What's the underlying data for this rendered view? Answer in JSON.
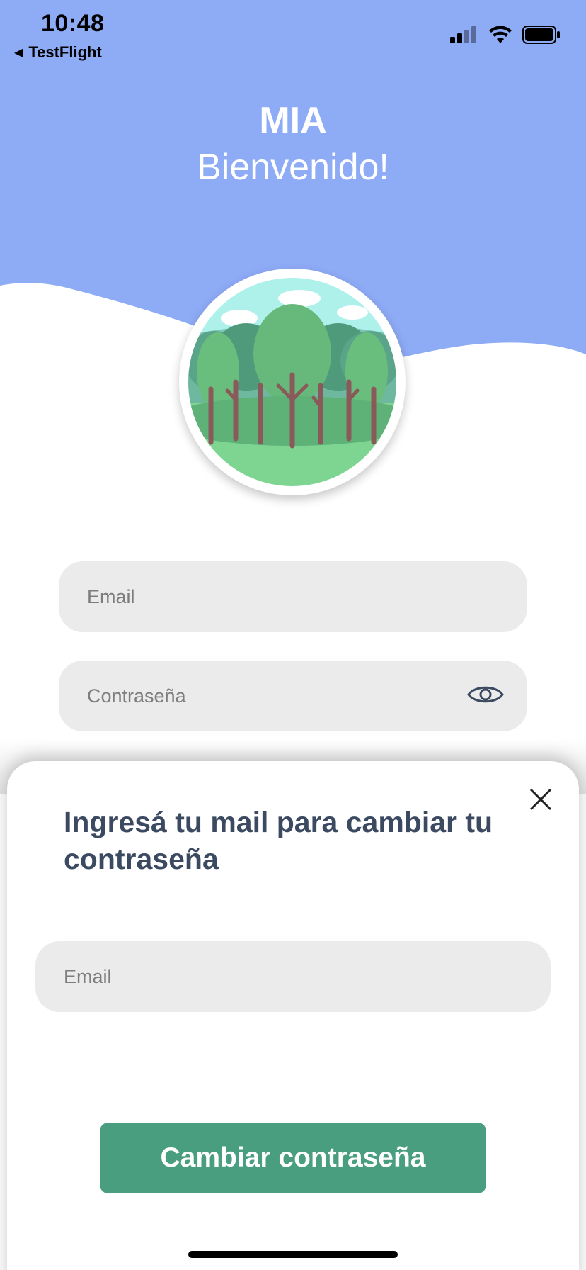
{
  "status_bar": {
    "time": "10:48",
    "back_app": "TestFlight",
    "icons": [
      "cellular-signal-icon",
      "wifi-icon",
      "battery-icon"
    ]
  },
  "header": {
    "app_title": "MIA",
    "welcome": "Bienvenido!",
    "background_color": "#8eabf6"
  },
  "login_form": {
    "email_placeholder": "Email",
    "password_placeholder": "Contraseña",
    "password_toggle_icon": "eye-icon"
  },
  "reset_sheet": {
    "title": "Ingresá tu mail para cambiar tu contraseña",
    "email_placeholder": "Email",
    "submit_label": "Cambiar contraseña",
    "close_icon": "close-icon",
    "button_color": "#489e7f",
    "title_color": "#3b4a60"
  }
}
